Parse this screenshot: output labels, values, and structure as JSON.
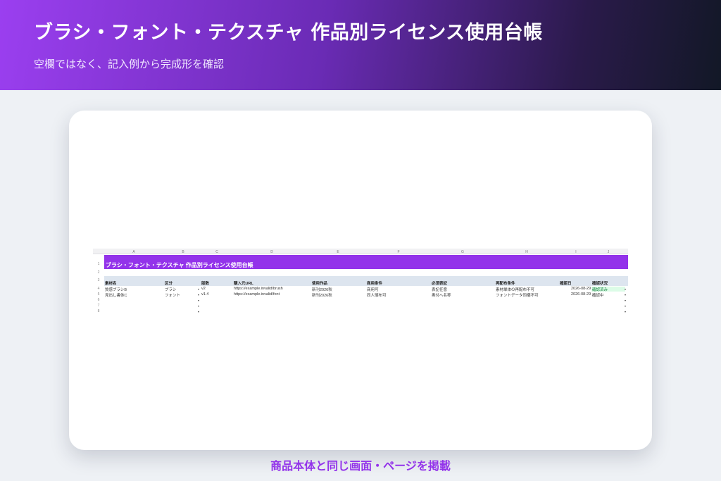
{
  "banner": {
    "title": "ブラシ・フォント・テクスチャ 作品別ライセンス使用台帳",
    "subtitle": "空欄ではなく、記入例から完成形を確認"
  },
  "sheet": {
    "column_letters": [
      "A",
      "B",
      "C",
      "D",
      "E",
      "F",
      "G",
      "H",
      "I",
      "J"
    ],
    "row_numbers": [
      "1",
      "2",
      "3",
      "4",
      "5",
      "6",
      "7",
      "8"
    ],
    "title": "ブラシ・フォント・テクスチャ 作品別ライセンス使用台帳",
    "headers": [
      "素材名",
      "区分",
      "版数",
      "購入元URL",
      "使用作品",
      "商用条件",
      "必須表記",
      "再配布条件",
      "確認日",
      "確認状況"
    ],
    "rows": [
      {
        "material": "質感ブラシB",
        "category": "ブラシ",
        "version": "v2",
        "url": "https://example.invalid/brush",
        "work": "新刊2026秋",
        "commercial": "商用可",
        "credit": "表記任意",
        "redistribution": "素材単体の再配布不可",
        "date": "2026-08-29",
        "status": "確認済み"
      },
      {
        "material": "見出し書体C",
        "category": "フォント",
        "version": "v1.4",
        "url": "https://example.invalid/font",
        "work": "新刊2026秋",
        "commercial": "同人頒布可",
        "credit": "奥付へ名称",
        "redistribution": "フォントデータ同梱不可",
        "date": "2026-08-29",
        "status": "確認中"
      }
    ],
    "dropdown_glyph": "▾"
  },
  "footer": {
    "note": "商品本体と同じ画面・ページを掲載"
  },
  "colors": {
    "accent": "#9333ea",
    "header_band": "#dde5ef",
    "status_ok_bg": "#dcfce7"
  }
}
